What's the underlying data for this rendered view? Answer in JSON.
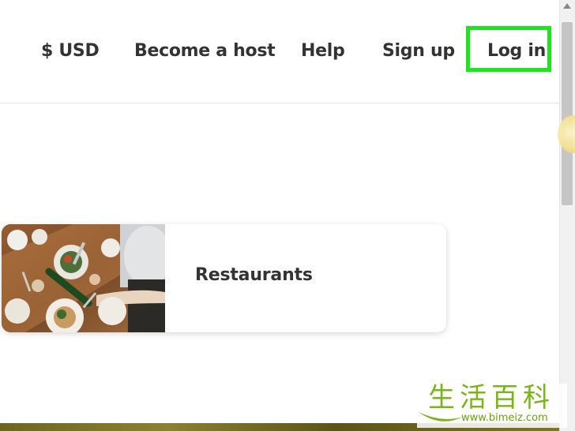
{
  "header": {
    "nav": {
      "currency_label": "$ USD",
      "become_host_label": "Become a host",
      "help_label": "Help",
      "signup_label": "Sign up",
      "login_label": "Log in"
    },
    "highlight_color": "#1ee51e"
  },
  "main": {
    "categories": [
      {
        "label": "Restaurants",
        "image": "restaurant-table-photo"
      }
    ]
  },
  "watermark": {
    "chars": "生活百科",
    "url": "www.bimeiz.com",
    "color": "#7bb31c"
  }
}
